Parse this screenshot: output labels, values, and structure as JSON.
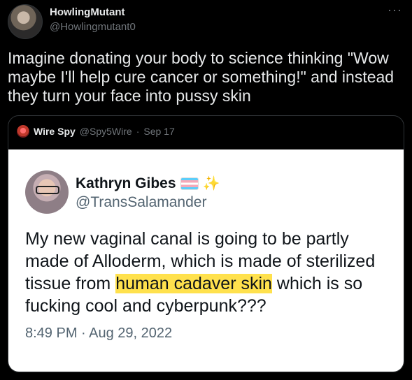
{
  "tweet": {
    "author_name": "HowlingMutant",
    "author_handle": "@Howlingmutant0",
    "more_icon": "more-horizontal-icon",
    "text": "Imagine donating your body to science thinking \"Wow maybe I'll help cure cancer or something!\" and instead they turn your face into pussy skin"
  },
  "quote": {
    "author_name": "Wire Spy",
    "author_handle": "@Spy5Wire",
    "separator": "·",
    "date": "Sep 17",
    "image": {
      "name": "Kathryn Gibes",
      "name_emoji": "✨",
      "handle": "@TransSalamander",
      "text_before": "My new vaginal canal is going to be partly made of Alloderm, which is made of sterilized tissue from ",
      "text_highlight": "human cadaver skin",
      "text_after": " which is so fucking cool and cyberpunk???",
      "timestamp": "8:49 PM · Aug 29, 2022",
      "highlight_color": "#ffe14d"
    }
  }
}
